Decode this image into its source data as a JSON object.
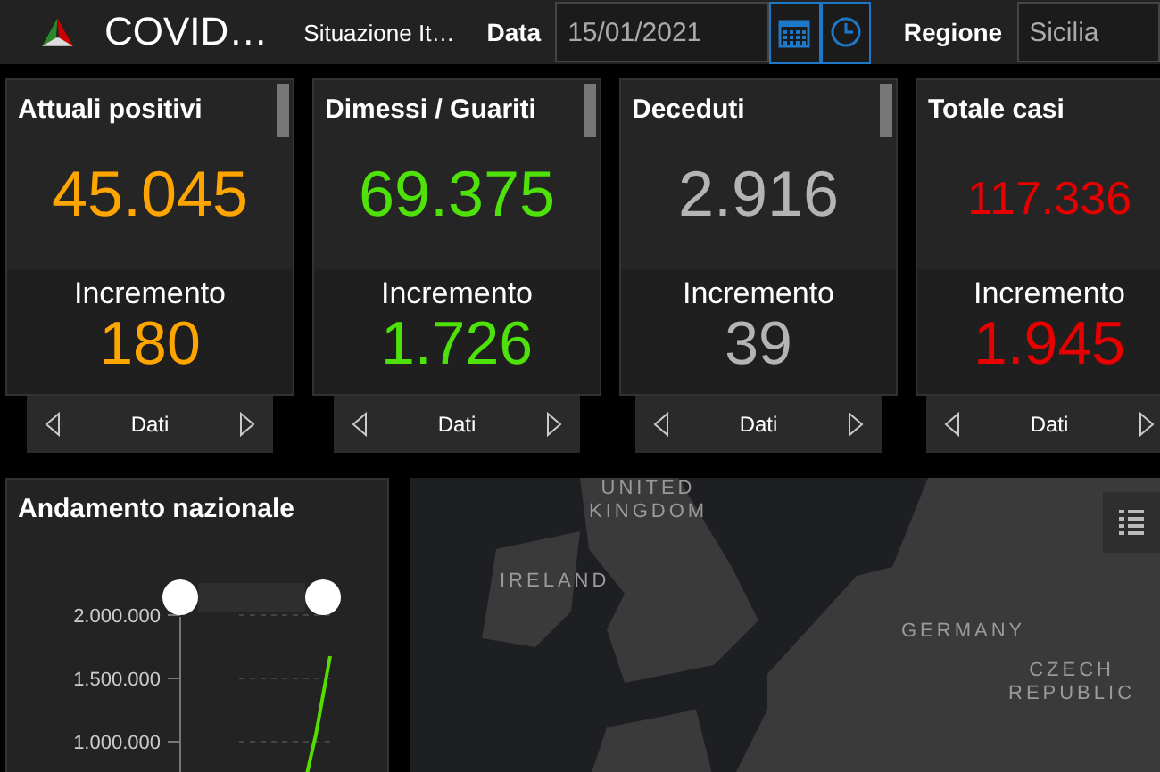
{
  "header": {
    "title": "COVID…",
    "subtitle": "Situazione It…",
    "date_label": "Data",
    "date_value": "15/01/2021",
    "region_label": "Regione",
    "region_value": "Sicilia"
  },
  "cards": [
    {
      "title": "Attuali positivi",
      "value": "45.045",
      "color": "#ffa500",
      "increment_label": "Incremento",
      "increment": "180",
      "nav_label": "Dati"
    },
    {
      "title": "Dimessi / Guariti",
      "value": "69.375",
      "color": "#4ee10a",
      "increment_label": "Incremento",
      "increment": "1.726",
      "nav_label": "Dati"
    },
    {
      "title": "Deceduti",
      "value": "2.916",
      "color": "#b4b4b4",
      "increment_label": "Incremento",
      "increment": "39",
      "nav_label": "Dati"
    },
    {
      "title": "Totale casi",
      "value": "117.336",
      "color": "#e60000",
      "increment_label": "Incremento",
      "increment": "1.945",
      "nav_label": "Dati"
    }
  ],
  "trend": {
    "title": "Andamento nazionale",
    "axis_labels": [
      "2.000.000",
      "1.500.000",
      "1.000.000"
    ]
  },
  "map": {
    "labels": [
      "UNITED\nKINGDOM",
      "IRELAND",
      "GERMANY",
      "CZECH\nREPUBLIC"
    ]
  }
}
